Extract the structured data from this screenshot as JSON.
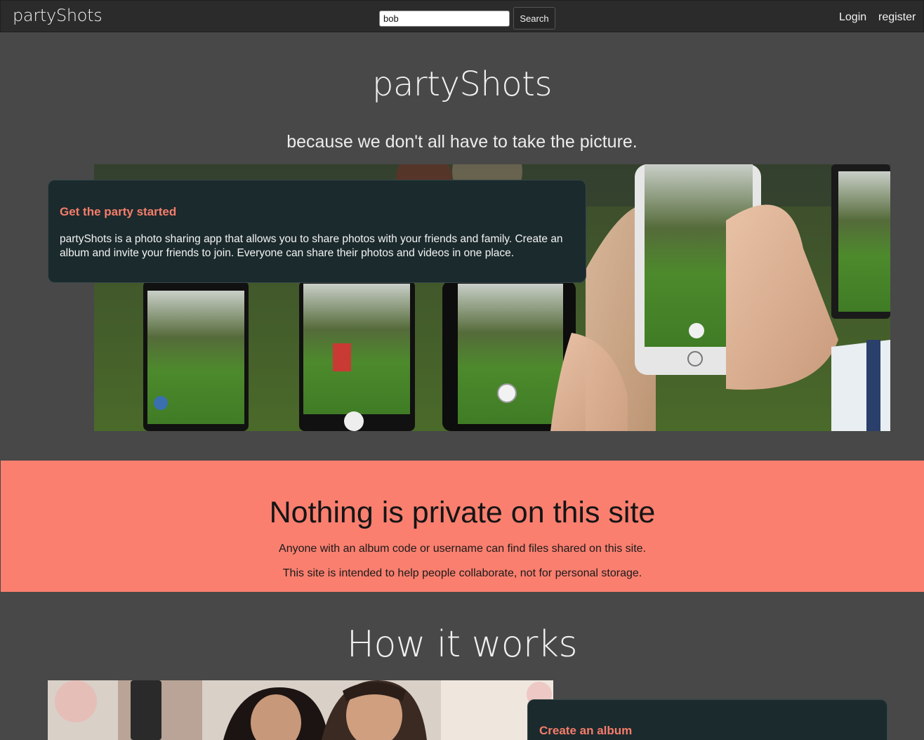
{
  "navbar": {
    "brand": "partyShots",
    "search_value": "bob",
    "search_button": "Search",
    "login": "Login",
    "register": "register"
  },
  "hero": {
    "title": "partyShots",
    "tagline": "because we don't all have to take the picture.",
    "photo_icon": "phones-photo-image"
  },
  "intro_card": {
    "title": "Get the party started",
    "body": "partyShots is a photo sharing app that allows you to share photos with your friends and family. Create an album and invite your friends to join. Everyone can share their photos and videos in one place."
  },
  "privacy_notice": {
    "title": "Nothing is private on this site",
    "line1": "Anyone with an album code or username can find files shared on this site.",
    "line2": "This site is intended to help people collaborate, not for personal storage."
  },
  "how_it_works": {
    "title": "How it works",
    "photo_icon": "couple-selfie-photo-image",
    "step1_title": "Create an album"
  },
  "colors": {
    "accent": "#f67d6b",
    "band": "#fa7f6f",
    "card": "#1b2a2d",
    "background": "#484848",
    "navbar": "#2b2b2b"
  }
}
